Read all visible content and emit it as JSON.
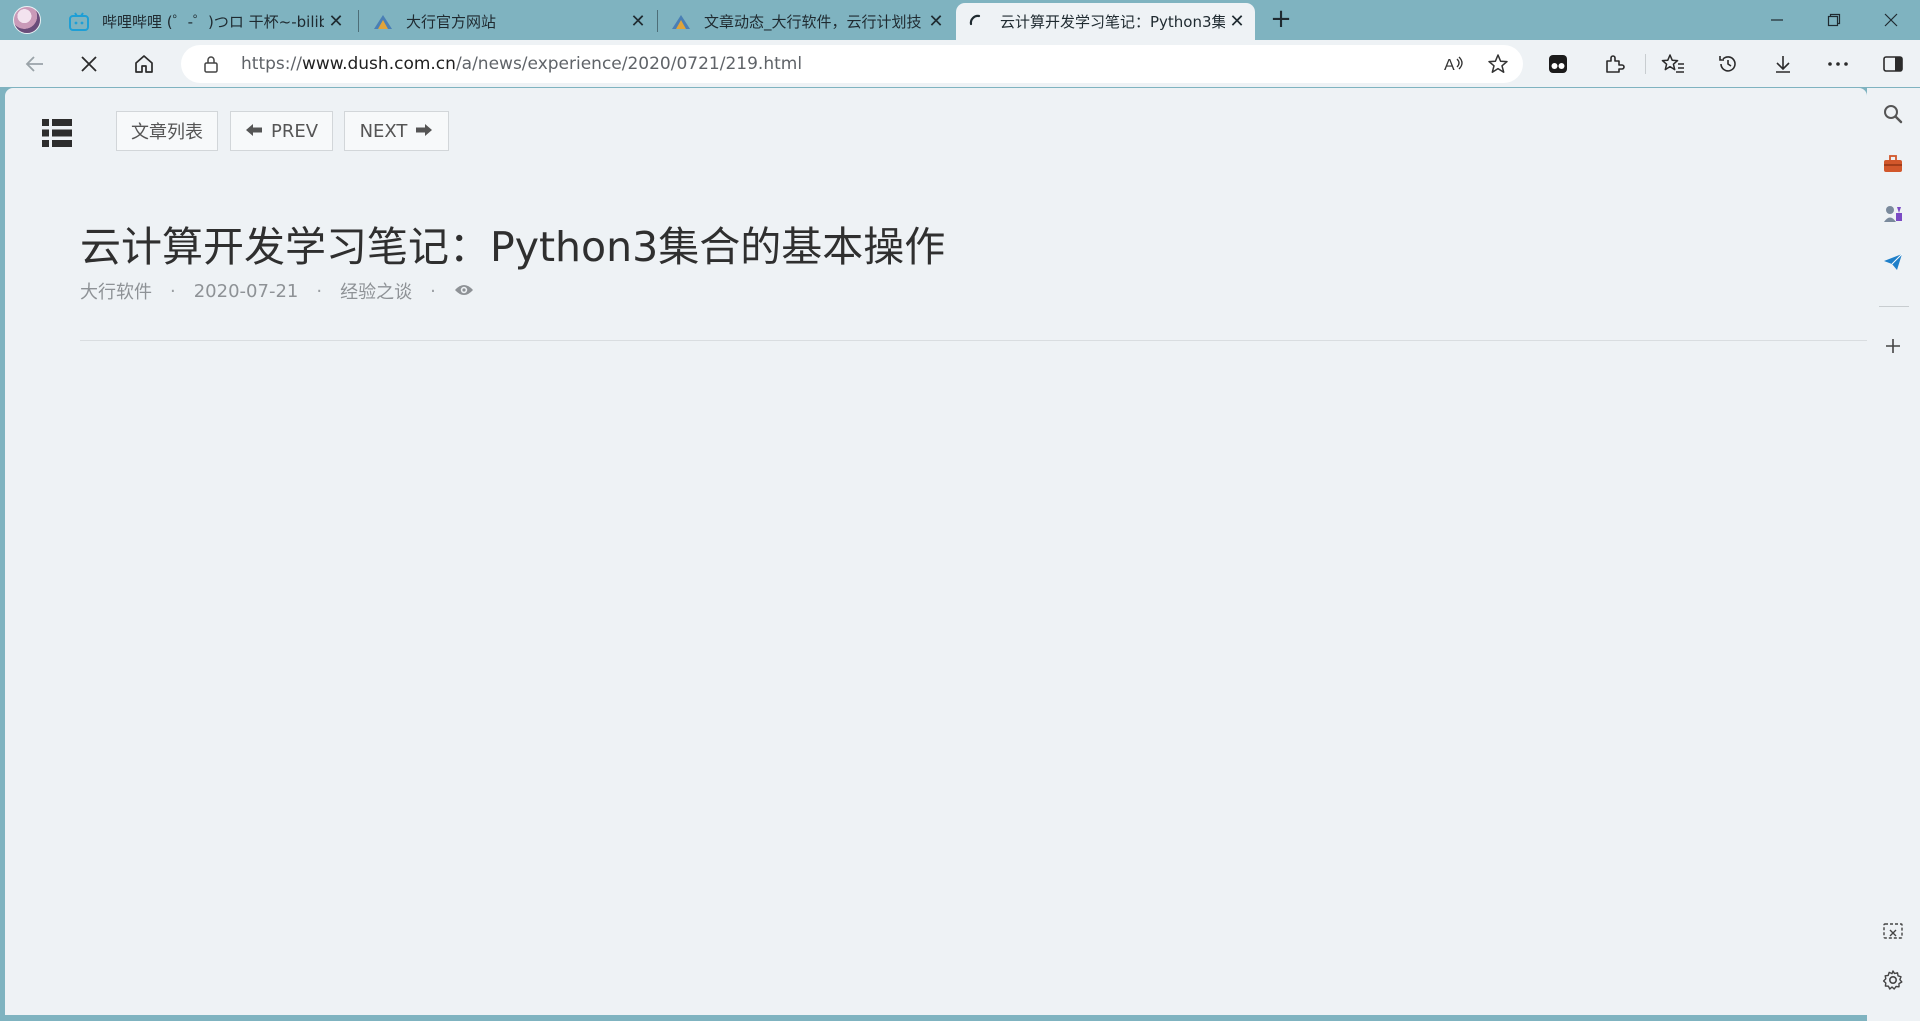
{
  "tabs": [
    {
      "title": "哔哩哔哩 (゜-゜)つロ 干杯~-bilib",
      "favicon": "bilibili-tv-icon",
      "active": false
    },
    {
      "title": "大行官方网站",
      "favicon": "dahang-logo-icon",
      "active": false
    },
    {
      "title": "文章动态_大行软件，云行计划技",
      "favicon": "dahang-logo-icon",
      "active": false
    },
    {
      "title": "云计算开发学习笔记：Python3集",
      "favicon": "loading-spinner-icon",
      "active": true
    }
  ],
  "address": {
    "scheme": "https://",
    "host": "www.dush.com.cn",
    "path": "/a/news/experience/2020/0721/219.html"
  },
  "page": {
    "list_button": "文章列表",
    "prev_button": "PREV",
    "next_button": "NEXT",
    "title": "云计算开发学习笔记：Python3集合的基本操作",
    "author": "大行软件",
    "date": "2020-07-21",
    "category": "经验之谈"
  },
  "colors": {
    "frame": "#7fb3c0",
    "page_bg": "#eef2f5",
    "text_dark": "#2f2f2f",
    "text_muted": "#8e9296"
  }
}
